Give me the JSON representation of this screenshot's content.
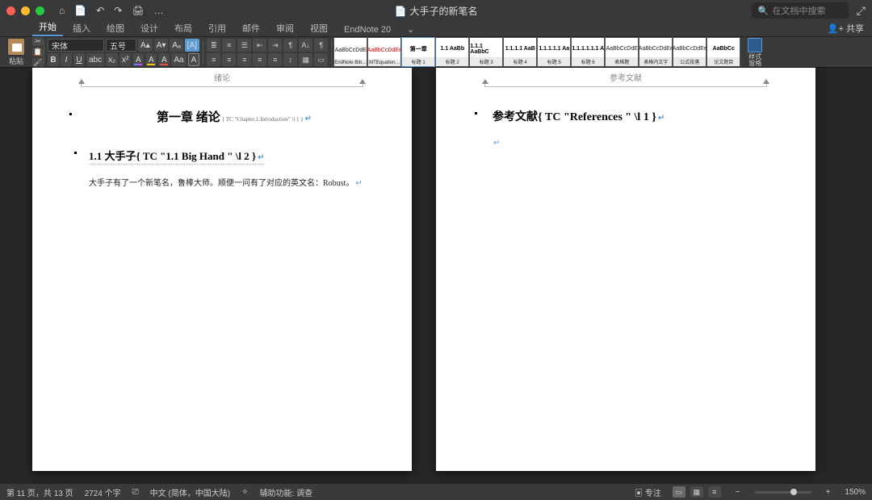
{
  "titlebar": {
    "doc_title": "大手子的新笔名",
    "search_placeholder": "在文档中搜索"
  },
  "qa": [
    "⌂",
    "📄",
    "↶",
    "↷",
    "🖨",
    "…"
  ],
  "tabs": {
    "items": [
      "开始",
      "插入",
      "绘图",
      "设计",
      "布局",
      "引用",
      "邮件",
      "审阅",
      "视图",
      "EndNote 20"
    ],
    "share": "共享",
    "expand": "⌄"
  },
  "ribbon": {
    "paste_label": "粘贴",
    "font_name": "宋体",
    "font_size": "五号",
    "style_pane": "样式\n窗格"
  },
  "styles": [
    {
      "preview": "AaBbCcDdE",
      "label": "EndNote Bibl…",
      "cls": ""
    },
    {
      "preview": "AaBbCcDdEe",
      "label": "MTEquation…",
      "cls": "red"
    },
    {
      "preview": "第一章",
      "label": "标题 1",
      "cls": "dark sel"
    },
    {
      "preview": "1.1  AaBb",
      "label": "标题 2",
      "cls": "dark"
    },
    {
      "preview": "1.1.1  AaBbC",
      "label": "标题 3",
      "cls": "dark"
    },
    {
      "preview": "1.1.1.1  AaB",
      "label": "标题 4",
      "cls": "dark"
    },
    {
      "preview": "1.1.1.1.1  Aa",
      "label": "标题 5",
      "cls": "dark"
    },
    {
      "preview": "1.1.1.1.1.1  A",
      "label": "标题 6",
      "cls": "dark"
    },
    {
      "preview": "AaBbCcDdE",
      "label": "表格题",
      "cls": ""
    },
    {
      "preview": "AaBbCcDdEe",
      "label": "表格内文字",
      "cls": ""
    },
    {
      "preview": "AaBbCcDdEe",
      "label": "公式段落",
      "cls": ""
    },
    {
      "preview": "AaBbCc",
      "label": "论文题目",
      "cls": "dark"
    }
  ],
  "pages": {
    "left": {
      "header": "绪论",
      "chapter": "第一章  绪论",
      "chapter_field": "{ TC  \"Chapter.1.Introduction\" \\l 1 }",
      "section": "1.1 大手子{  TC   \"1.1 Big Hand \" \\l 2  }",
      "body": "大手子有了一个新笔名，鲁棒大师。顺便一问有了对应的英文名：Robust。"
    },
    "right": {
      "header": "参考文献",
      "title": "参考文献{  TC   \"References \" \\l 1  }"
    }
  },
  "status": {
    "page": "第 11 页，共 13 页",
    "words": "2724 个字",
    "lang_icon": "⎚",
    "lang": "中文 (简体，中国大陆)",
    "a11y_icon": "✧",
    "a11y": "辅助功能: 调查",
    "focus": "专注",
    "zoom": "150%"
  }
}
